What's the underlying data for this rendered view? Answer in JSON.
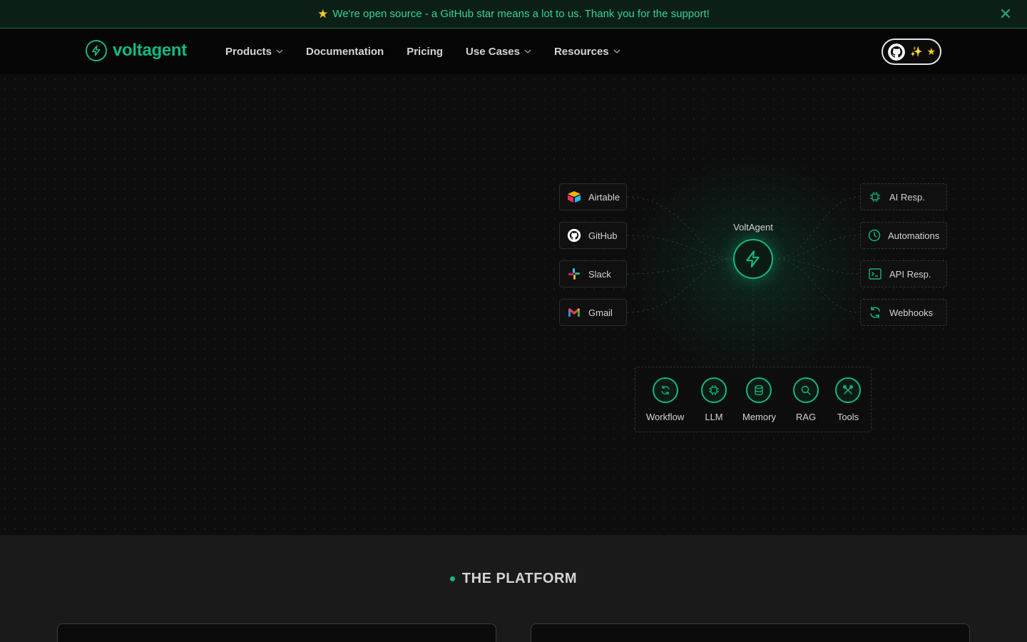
{
  "banner": {
    "star_icon": "star-emoji",
    "text": "We're open source - a GitHub star means a lot to us. Thank you for the support!"
  },
  "header": {
    "logo_text": "voltagent",
    "nav": [
      {
        "label": "Products",
        "has_dropdown": true
      },
      {
        "label": "Documentation",
        "has_dropdown": false
      },
      {
        "label": "Pricing",
        "has_dropdown": false
      },
      {
        "label": "Use Cases",
        "has_dropdown": true
      },
      {
        "label": "Resources",
        "has_dropdown": true
      }
    ],
    "github_button": {
      "icons": [
        "github-icon",
        "sparkles-icon",
        "star-icon"
      ]
    }
  },
  "hero": {
    "integrations": [
      {
        "label": "Airtable",
        "icon": "airtable-icon"
      },
      {
        "label": "GitHub",
        "icon": "github-icon"
      },
      {
        "label": "Slack",
        "icon": "slack-icon"
      },
      {
        "label": "Gmail",
        "icon": "gmail-icon"
      }
    ],
    "center": {
      "label": "VoltAgent",
      "icon": "bolt-icon"
    },
    "outputs": [
      {
        "label": "AI Resp.",
        "icon": "chip-icon"
      },
      {
        "label": "Automations",
        "icon": "clock-icon"
      },
      {
        "label": "API Resp.",
        "icon": "terminal-icon"
      },
      {
        "label": "Webhooks",
        "icon": "refresh-icon"
      }
    ],
    "core": [
      {
        "label": "Workflow",
        "icon": "workflow-icon"
      },
      {
        "label": "LLM",
        "icon": "chip-icon"
      },
      {
        "label": "Memory",
        "icon": "database-icon"
      },
      {
        "label": "RAG",
        "icon": "search-icon"
      },
      {
        "label": "Tools",
        "icon": "tools-icon"
      }
    ]
  },
  "platform": {
    "title": "THE PLATFORM"
  },
  "colors": {
    "accent": "#10b981",
    "background": "#0b0b0b",
    "banner_bg": "#0b1f17"
  }
}
